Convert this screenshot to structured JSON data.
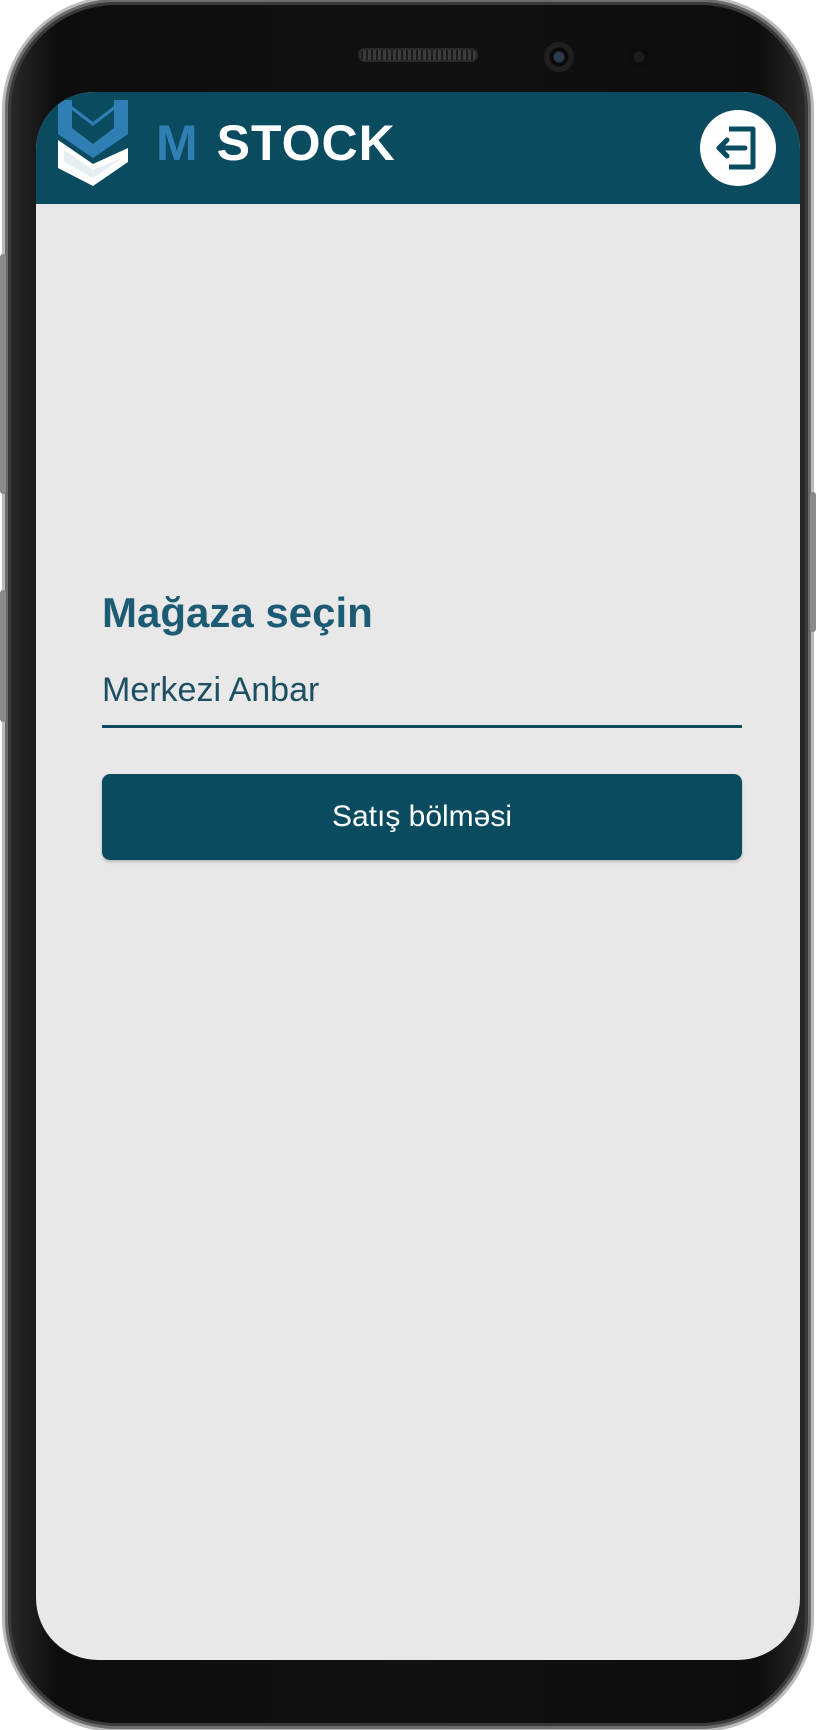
{
  "header": {
    "logo_letter": "M",
    "logo_text": "STOCK",
    "logout_icon": "logout-icon"
  },
  "form": {
    "label": "Mağaza seçin",
    "selected_store": "Merkezi Anbar",
    "submit_label": "Satış bölməsi"
  },
  "colors": {
    "primary": "#0b4b60",
    "accent": "#2f7fb4",
    "background": "#e8e8e8"
  }
}
